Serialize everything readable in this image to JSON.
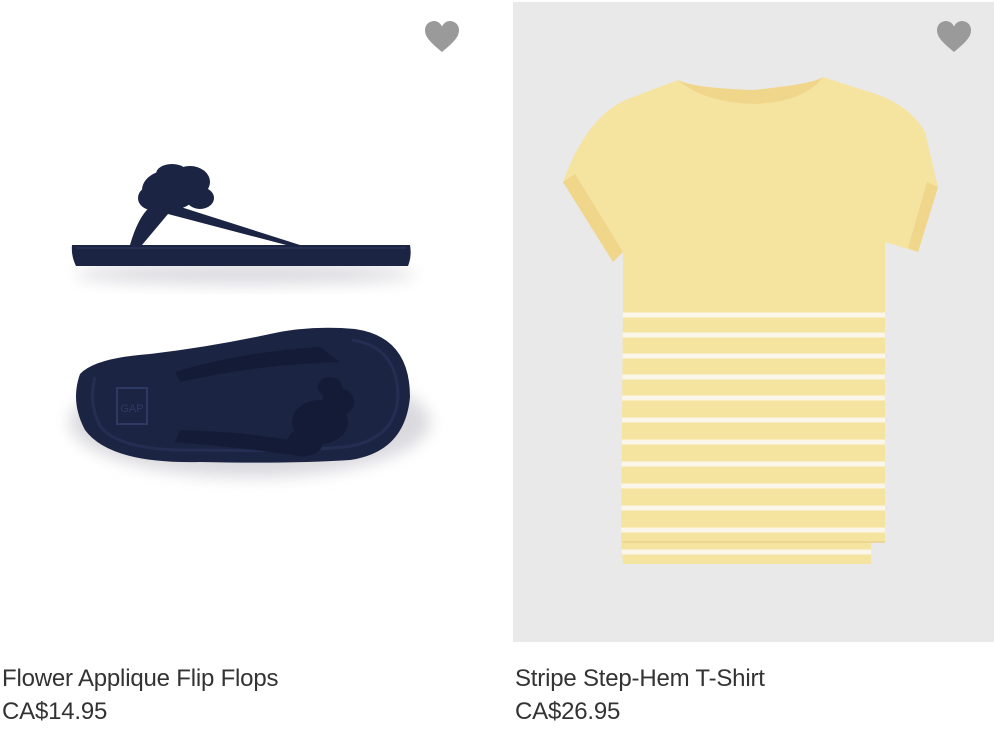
{
  "products": [
    {
      "name": "Flower Applique Flip Flops",
      "price": "CA$14.95",
      "image_description": "navy flip flop sandals with flower applique",
      "favorite_icon": "heart-icon",
      "colors": {
        "product": "#1c2444",
        "image_background": "#ffffff",
        "heart": "#9a9a9a"
      }
    },
    {
      "name": "Stripe Step-Hem T-Shirt",
      "price": "CA$26.95",
      "image_description": "yellow t-shirt with white horizontal stripes",
      "favorite_icon": "heart-icon",
      "colors": {
        "product": "#f5e3a0",
        "stripe": "#faf6ea",
        "image_background": "#e9e9ea",
        "heart": "#9a9a9a"
      }
    }
  ]
}
